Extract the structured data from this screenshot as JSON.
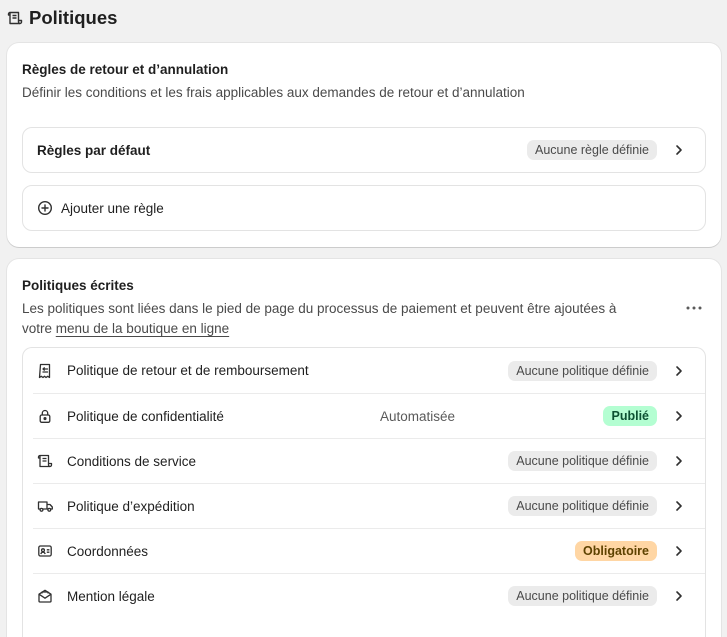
{
  "page": {
    "title": "Politiques",
    "icon": "policy-document-icon"
  },
  "return_rules": {
    "title": "Règles de retour et d’annulation",
    "description": "Définir les conditions et les frais applicables aux demandes de retour et d’annulation",
    "default_rule": {
      "label": "Règles par défaut",
      "badge": "Aucune règle définie"
    },
    "add_rule": {
      "label": "Ajouter une règle",
      "icon": "plus-circle-icon"
    }
  },
  "written_policies": {
    "title": "Politiques écrites",
    "description_line1": "Les politiques sont liées dans le pied de page du processus de paiement et peuvent être ajoutées à",
    "description_prefix": "votre ",
    "description_link": "menu de la boutique en ligne",
    "more_icon": "more-horizontal-icon",
    "items": [
      {
        "label": "Politique de retour et de remboursement",
        "icon": "receipt-refund-icon",
        "meta": "",
        "badge": "Aucune politique définie",
        "badge_tone": "grey"
      },
      {
        "label": "Politique de confidentialité",
        "icon": "lock-icon",
        "meta": "Automatisée",
        "badge": "Publié",
        "badge_tone": "green"
      },
      {
        "label": "Conditions de service",
        "icon": "document-terms-icon",
        "meta": "",
        "badge": "Aucune politique définie",
        "badge_tone": "grey"
      },
      {
        "label": "Politique d’expédition",
        "icon": "delivery-truck-icon",
        "meta": "",
        "badge": "Aucune politique définie",
        "badge_tone": "grey"
      },
      {
        "label": "Coordonnées",
        "icon": "contact-card-icon",
        "meta": "",
        "badge": "Obligatoire",
        "badge_tone": "orange"
      },
      {
        "label": "Mention légale",
        "icon": "legal-mail-icon",
        "meta": "",
        "badge": "Aucune politique définie",
        "badge_tone": "grey"
      }
    ]
  },
  "colors": {
    "background": "#f1f1f1",
    "card": "#ffffff",
    "badge_grey": "#ebebeb",
    "badge_green": "#b4fed2",
    "badge_orange": "#ffd6a4"
  }
}
